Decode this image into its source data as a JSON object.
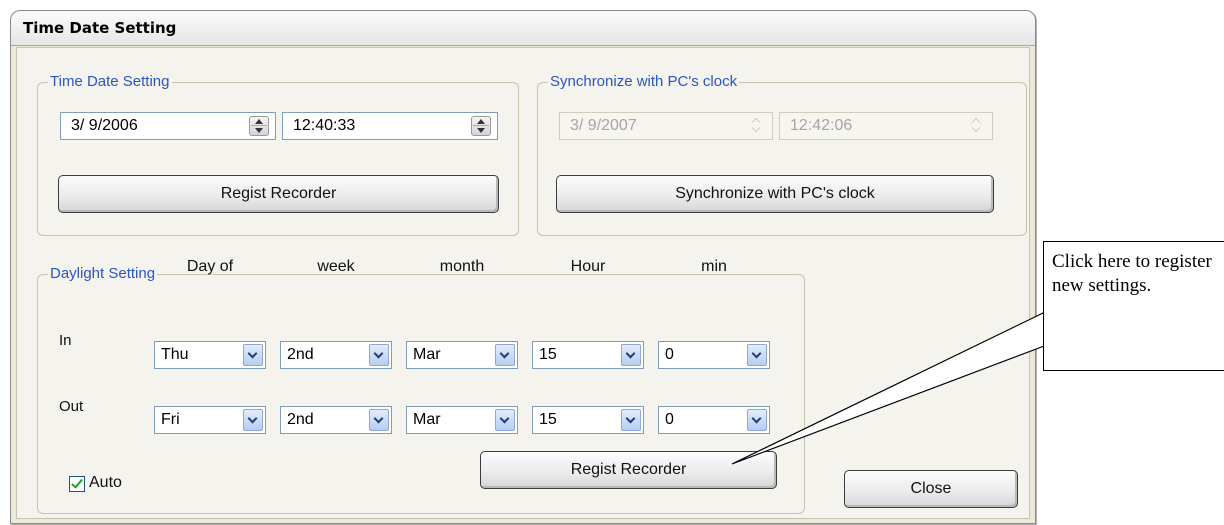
{
  "window": {
    "title": "Time Date Setting"
  },
  "time_date_group": {
    "legend": "Time Date Setting",
    "date_value": "3/ 9/2006",
    "time_value": "12:40:33",
    "regist_button": "Regist Recorder"
  },
  "sync_group": {
    "legend": "Synchronize with PC's clock",
    "date_value": "3/ 9/2007",
    "time_value": "12:42:06",
    "sync_button": "Synchronize with PC's clock"
  },
  "daylight_group": {
    "legend": "Daylight Setting",
    "columns": [
      "Day of",
      "week",
      "month",
      "Hour",
      "min"
    ],
    "rows": [
      {
        "label": "In",
        "values": [
          "Thu",
          "2nd",
          "Mar",
          "15",
          "0"
        ]
      },
      {
        "label": "Out",
        "values": [
          "Fri",
          "2nd",
          "Mar",
          "15",
          "0"
        ]
      }
    ],
    "auto_label": "Auto",
    "auto_checked": true,
    "regist_button": "Regist Recorder"
  },
  "close_button": "Close",
  "callout": {
    "text": "Click here to register new settings."
  }
}
